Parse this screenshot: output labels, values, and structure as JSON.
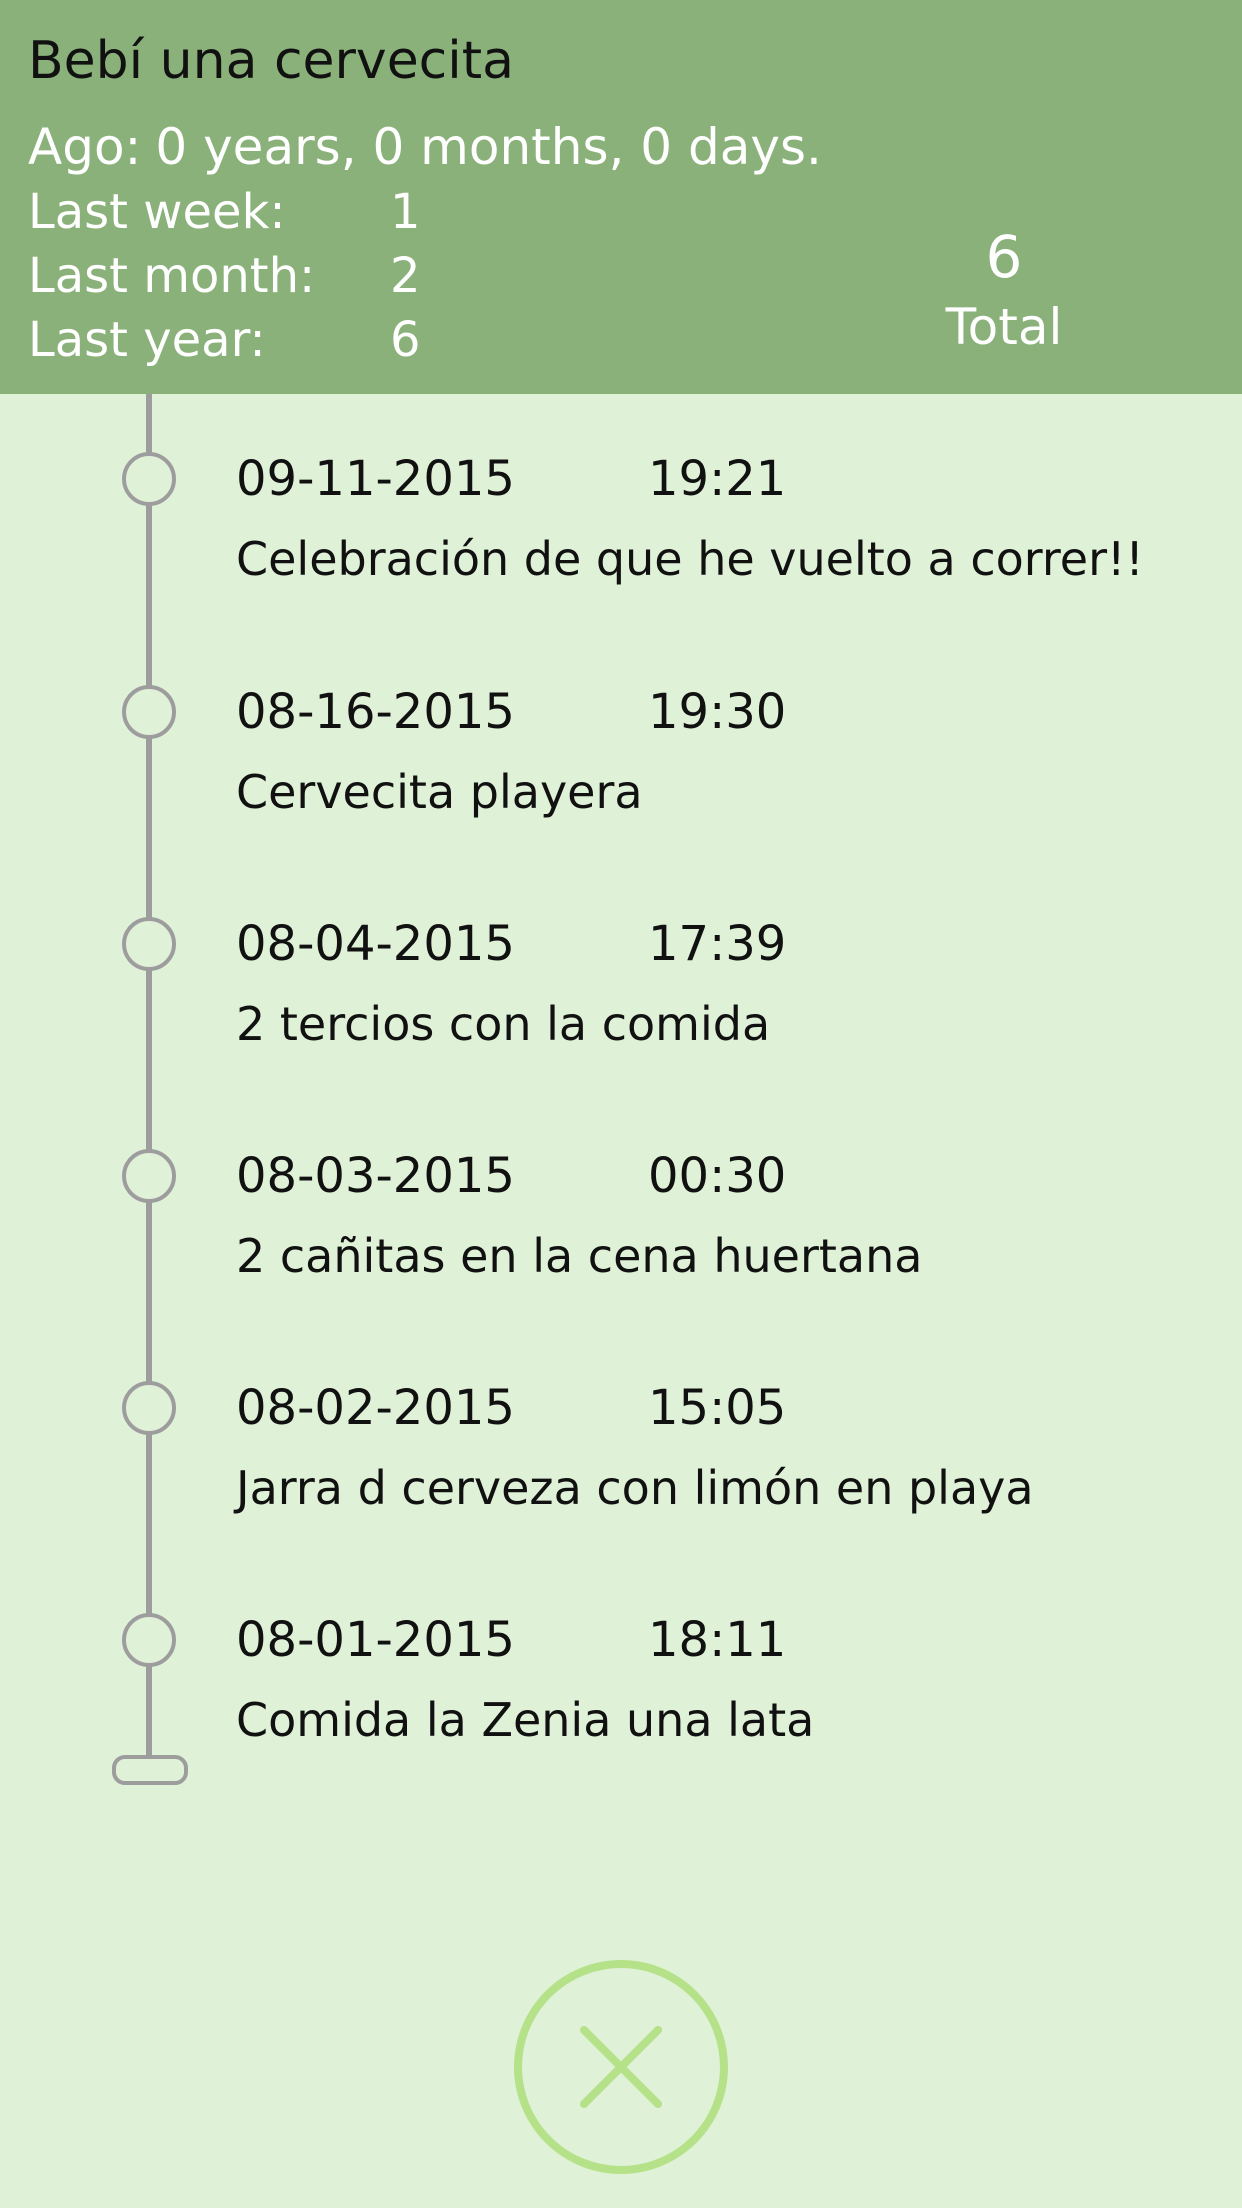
{
  "header": {
    "title": "Bebí una cervecita",
    "ago_label": "Ago:",
    "ago_value": "0 years, 0 months, 0 days.",
    "last_week_label": "Last week:",
    "last_week_value": "1",
    "last_month_label": "Last month:",
    "last_month_value": "2",
    "last_year_label": "Last year:",
    "last_year_value": "6",
    "total_value": "6",
    "total_label": "Total"
  },
  "entries": [
    {
      "date": "09-11-2015",
      "time": "19:21",
      "description": "Celebración de que he vuelto a correr!!"
    },
    {
      "date": "08-16-2015",
      "time": "19:30",
      "description": "Cervecita playera"
    },
    {
      "date": "08-04-2015",
      "time": "17:39",
      "description": "2 tercios con la comida"
    },
    {
      "date": "08-03-2015",
      "time": "00:30",
      "description": "2 cañitas en la cena huertana"
    },
    {
      "date": "08-02-2015",
      "time": "15:05",
      "description": "Jarra d cerveza con limón en playa"
    },
    {
      "date": "08-01-2015",
      "time": "18:11",
      "description": "Comida la Zenia una lata"
    }
  ],
  "close_button": {
    "icon": "close-icon",
    "color": "#b5e189"
  },
  "colors": {
    "header_bg": "#8ab17a",
    "page_bg": "#dff1d7",
    "timeline": "#9d9d9d"
  }
}
